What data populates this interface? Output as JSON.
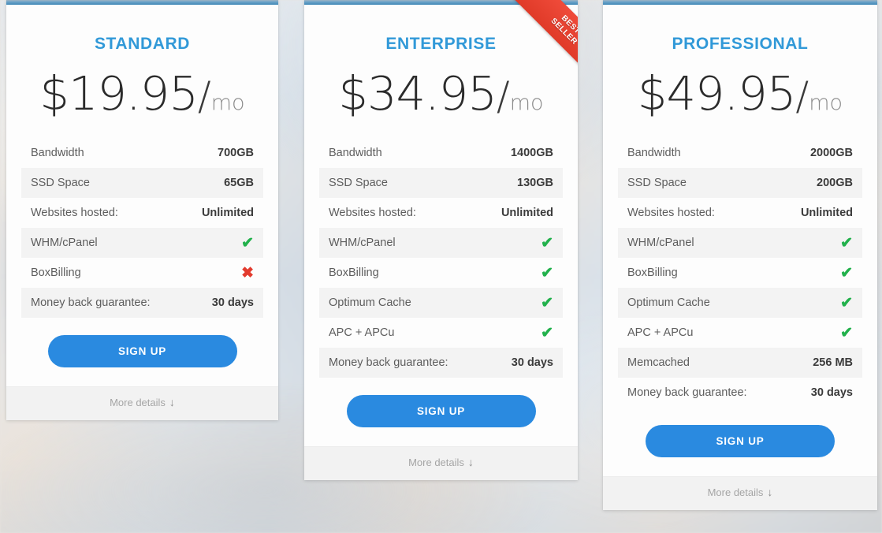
{
  "plans": [
    {
      "id": "standard",
      "name": "STANDARD",
      "currency": "$",
      "price": "19.95",
      "slash": "/",
      "period": "mo",
      "badge": null,
      "features": [
        {
          "label": "Bandwidth",
          "value": "700GB",
          "type": "text"
        },
        {
          "label": "SSD Space",
          "value": "65GB",
          "type": "text"
        },
        {
          "label": "Websites hosted:",
          "value": "Unlimited",
          "type": "text"
        },
        {
          "label": "WHM/cPanel",
          "value": "✔",
          "type": "check",
          "icon": "check-icon"
        },
        {
          "label": "BoxBilling",
          "value": "✖",
          "type": "cross",
          "icon": "cross-icon"
        },
        {
          "label": "Money back guarantee:",
          "value": "30 days",
          "type": "text"
        }
      ],
      "signup_label": "SIGN UP",
      "more_details_label": "More details",
      "more_details_arrow": "↓"
    },
    {
      "id": "enterprise",
      "name": "ENTERPRISE",
      "currency": "$",
      "price": "34.95",
      "slash": "/",
      "period": "mo",
      "badge": {
        "line1": "BEST",
        "line2": "SELLER",
        "color": "#e03a28"
      },
      "features": [
        {
          "label": "Bandwidth",
          "value": "1400GB",
          "type": "text"
        },
        {
          "label": "SSD Space",
          "value": "130GB",
          "type": "text"
        },
        {
          "label": "Websites hosted:",
          "value": "Unlimited",
          "type": "text"
        },
        {
          "label": "WHM/cPanel",
          "value": "✔",
          "type": "check",
          "icon": "check-icon"
        },
        {
          "label": "BoxBilling",
          "value": "✔",
          "type": "check",
          "icon": "check-icon"
        },
        {
          "label": "Optimum Cache",
          "value": "✔",
          "type": "check",
          "icon": "check-icon"
        },
        {
          "label": "APC + APCu",
          "value": "✔",
          "type": "check",
          "icon": "check-icon"
        },
        {
          "label": "Money back guarantee:",
          "value": "30 days",
          "type": "text"
        }
      ],
      "signup_label": "SIGN UP",
      "more_details_label": "More details",
      "more_details_arrow": "↓"
    },
    {
      "id": "professional",
      "name": "PROFESSIONAL",
      "currency": "$",
      "price": "49.95",
      "slash": "/",
      "period": "mo",
      "badge": null,
      "features": [
        {
          "label": "Bandwidth",
          "value": "2000GB",
          "type": "text"
        },
        {
          "label": "SSD Space",
          "value": "200GB",
          "type": "text"
        },
        {
          "label": "Websites hosted:",
          "value": "Unlimited",
          "type": "text"
        },
        {
          "label": "WHM/cPanel",
          "value": "✔",
          "type": "check",
          "icon": "check-icon"
        },
        {
          "label": "BoxBilling",
          "value": "✔",
          "type": "check",
          "icon": "check-icon"
        },
        {
          "label": "Optimum Cache",
          "value": "✔",
          "type": "check",
          "icon": "check-icon"
        },
        {
          "label": "APC + APCu",
          "value": "✔",
          "type": "check",
          "icon": "check-icon"
        },
        {
          "label": "Memcached",
          "value": "256 MB",
          "type": "text"
        },
        {
          "label": "Money back guarantee:",
          "value": "30 days",
          "type": "text"
        }
      ],
      "signup_label": "SIGN UP",
      "more_details_label": "More details",
      "more_details_arrow": "↓"
    }
  ],
  "colors": {
    "plan_name": "#3199d8",
    "signup_button": "#2a8ae0",
    "check": "#22b14c",
    "cross": "#e23b2e",
    "ribbon": "#e03a28",
    "top_bar": "#3f87b5",
    "row_alt": "#f3f3f3",
    "footer": "#f2f2f2"
  }
}
